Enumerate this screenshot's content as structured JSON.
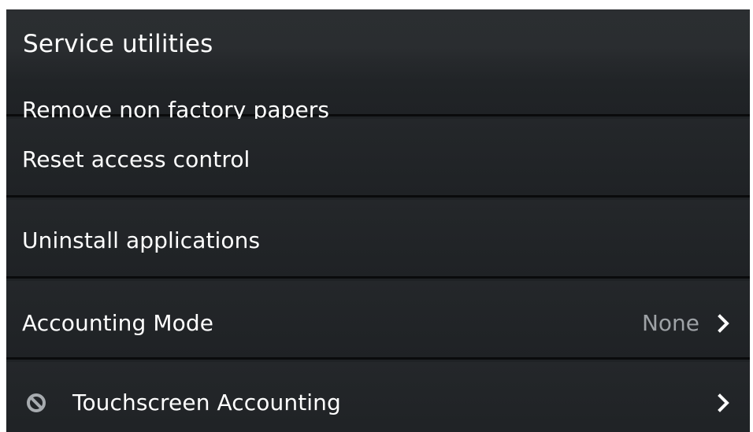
{
  "header": {
    "title": "Service utilities"
  },
  "rows": [
    {
      "label": "Remove non factory papers"
    },
    {
      "label": "Reset access control"
    },
    {
      "label": "Uninstall applications"
    },
    {
      "label": "Accounting Mode",
      "value": "None",
      "icon_right": "chevron-right-icon"
    },
    {
      "label": "Touchscreen Accounting",
      "icon_left": "blocked-icon",
      "icon_right": "chevron-right-icon"
    }
  ],
  "colors": {
    "background": "#1f2225",
    "text": "#ffffff",
    "secondary_text": "#9ea2a6",
    "divider": "#0a0b0c"
  }
}
